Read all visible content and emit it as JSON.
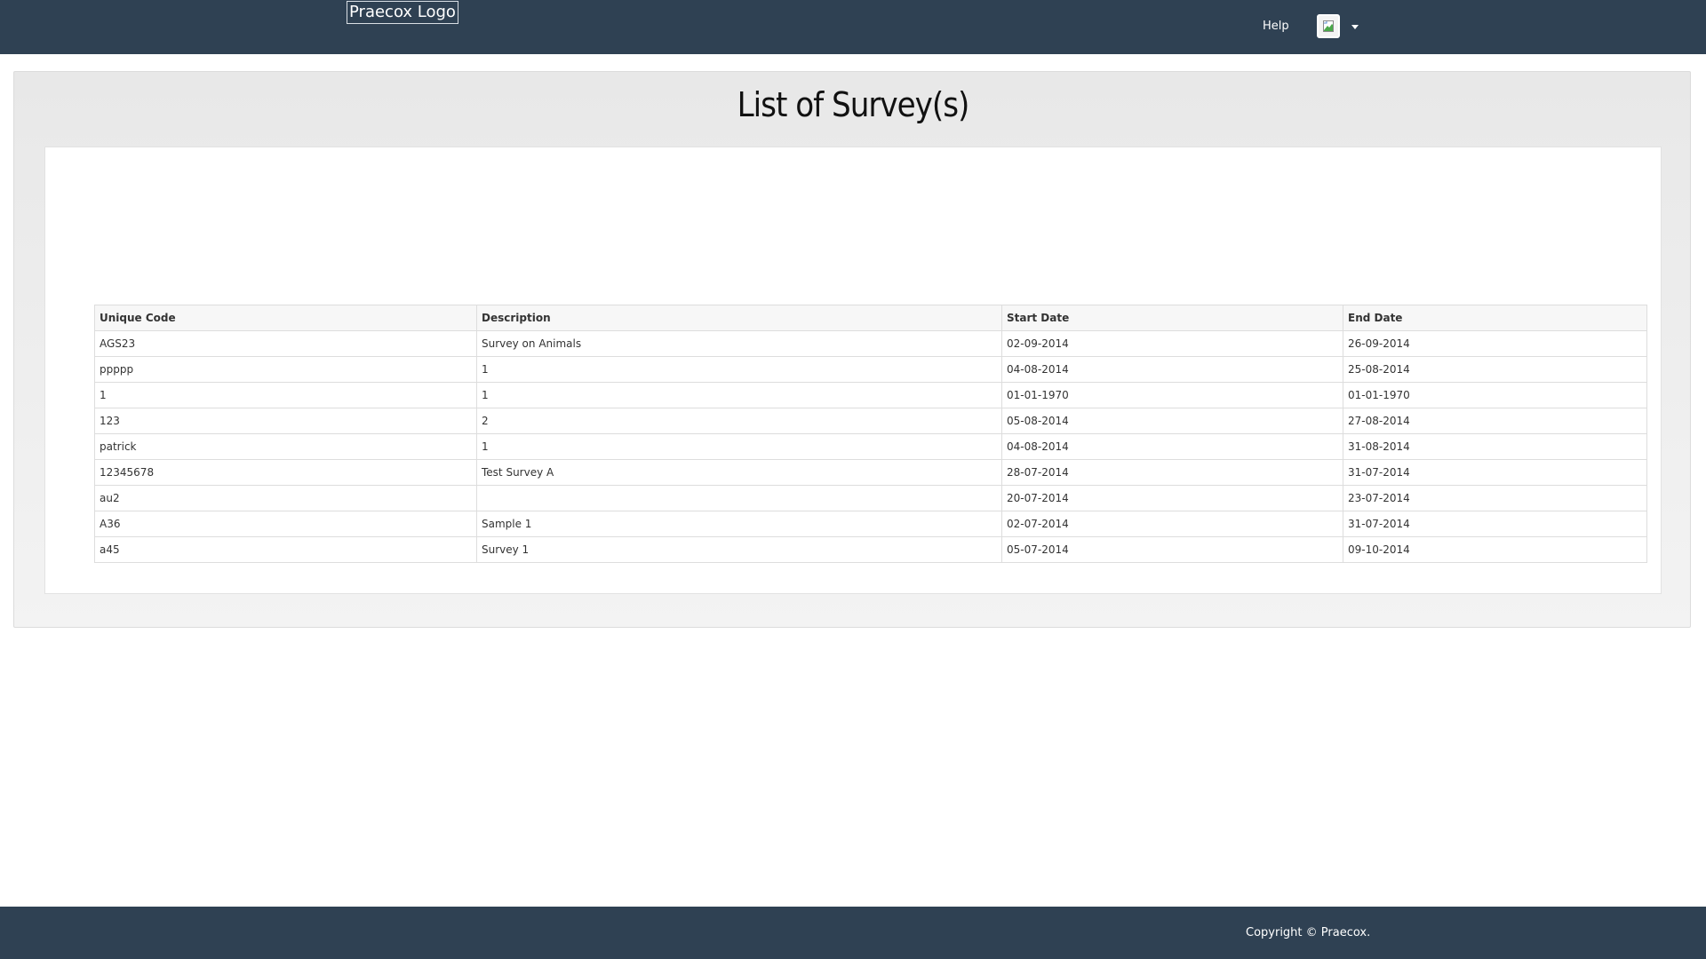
{
  "header": {
    "logo_text": "Praecox Logo",
    "help_label": "Help",
    "user_menu_icon": "broken-image-icon"
  },
  "main": {
    "title": "List of Survey(s)",
    "table": {
      "columns": [
        "Unique Code",
        "Description",
        "Start Date",
        "End Date"
      ],
      "rows": [
        [
          "AGS23",
          "Survey on Animals",
          "02-09-2014",
          "26-09-2014"
        ],
        [
          "ppppp",
          "1",
          "04-08-2014",
          "25-08-2014"
        ],
        [
          "1",
          "1",
          "01-01-1970",
          "01-01-1970"
        ],
        [
          "123",
          "2",
          "05-08-2014",
          "27-08-2014"
        ],
        [
          "patrick",
          "1",
          "04-08-2014",
          "31-08-2014"
        ],
        [
          "12345678",
          "Test Survey A",
          "28-07-2014",
          "31-07-2014"
        ],
        [
          "au2",
          "",
          "20-07-2014",
          "23-07-2014"
        ],
        [
          "A36",
          "Sample 1",
          "02-07-2014",
          "31-07-2014"
        ],
        [
          "a45",
          "Survey 1",
          "05-07-2014",
          "09-10-2014"
        ]
      ]
    }
  },
  "footer": {
    "copyright": "Copyright © Praecox."
  },
  "colors": {
    "navbar": "#2f4153",
    "panel": "#e8e8e8",
    "table_border": "#dddddd"
  }
}
